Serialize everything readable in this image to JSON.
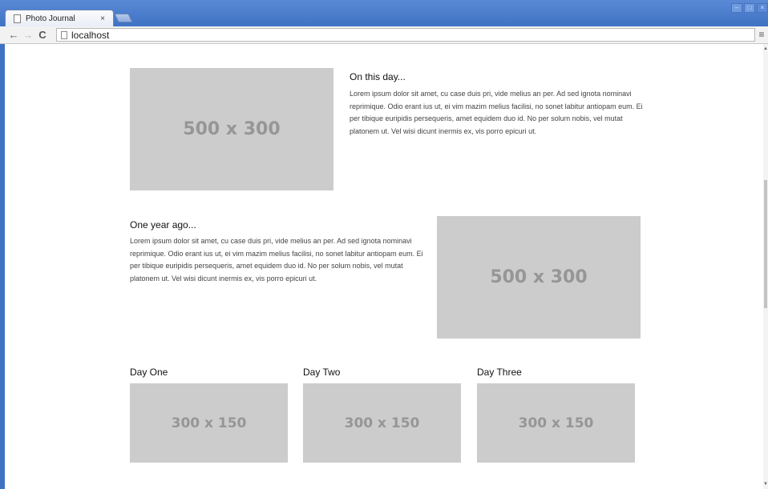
{
  "browser": {
    "tab_title": "Photo Journal",
    "tab_close": "×",
    "url": "localhost",
    "back": "←",
    "forward": "→",
    "reload": "C",
    "menu": "≡",
    "win_minimize": "–",
    "win_maximize": "□",
    "win_close": "×"
  },
  "sections": {
    "on_this_day": {
      "heading": "On this day...",
      "image_label": "500 x 300",
      "text": "Lorem ipsum dolor sit amet, cu case duis pri, vide melius an per. Ad sed ignota nominavi reprimique. Odio erant ius ut, ei vim mazim melius facilisi, no sonet labitur antiopam eum. Ei per tibique euripidis persequeris, amet equidem duo id. No per solum nobis, vel mutat platonem ut. Vel wisi dicunt inermis ex, vis porro epicuri ut."
    },
    "one_year_ago": {
      "heading": "One year ago...",
      "image_label": "500 x 300",
      "text": "Lorem ipsum dolor sit amet, cu case duis pri, vide melius an per. Ad sed ignota nominavi reprimique. Odio erant ius ut, ei vim mazim melius facilisi, no sonet labitur antiopam eum. Ei per tibique euripidis persequeris, amet equidem duo id. No per solum nobis, vel mutat platonem ut. Vel wisi dicunt inermis ex, vis porro epicuri ut."
    },
    "days": [
      {
        "heading": "Day One",
        "image_label": "300 x 150"
      },
      {
        "heading": "Day Two",
        "image_label": "300 x 150"
      },
      {
        "heading": "Day Three",
        "image_label": "300 x 150"
      }
    ]
  },
  "colors": {
    "placeholder_bg": "#cccccc",
    "placeholder_text": "#969696",
    "chrome_blue": "#3f72c4"
  }
}
